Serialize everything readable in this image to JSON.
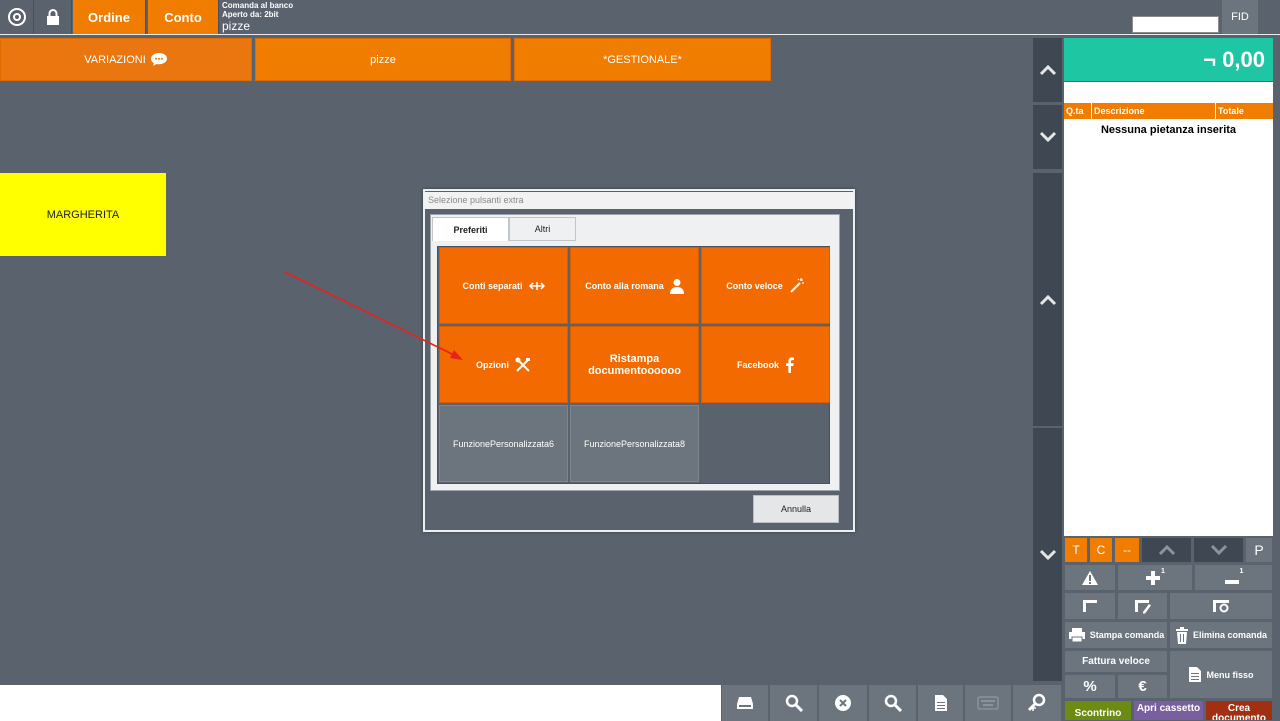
{
  "topbar": {
    "ordine": "Ordine",
    "conto": "Conto",
    "info_line1": "Comanda al banco",
    "info_line2": "Aperto da: 2bit",
    "info_line3": "pizze",
    "fid": "FID"
  },
  "categories": [
    "VARIAZIONI",
    "pizze",
    "*GESTIONALE*"
  ],
  "products": [
    "MARGHERITA"
  ],
  "receipt": {
    "total": "¬ 0,00",
    "col_qty": "Q.ta",
    "col_desc": "Descrizione",
    "col_total": "Totale",
    "empty": "Nessuna pietanza inserita"
  },
  "panel": {
    "t": "T",
    "c": "C",
    "dash": "--",
    "p": "P",
    "plus_badge": "1",
    "minus_badge": "1",
    "stampa": "Stampa comanda",
    "elimina": "Elimina comanda",
    "fattura": "Fattura veloce",
    "menu_fisso": "Menu fisso",
    "percent": "%",
    "euro": "€",
    "scontrino": "Scontrino",
    "apri": "Apri cassetto",
    "crea": "Crea documento"
  },
  "modal": {
    "title": "Selezione pulsanti extra",
    "tabs": [
      "Preferiti",
      "Altri"
    ],
    "buttons": [
      "Conti separati",
      "Conto alla romana",
      "Conto veloce",
      "Opzioni",
      "Ristampa documentoooooo",
      "Facebook",
      "FunzionePersonalizzata6",
      "FunzionePersonalizzata8"
    ],
    "cancel": "Annulla"
  },
  "colors": {
    "orange": "#f07c00",
    "teal": "#1fc6a4",
    "background": "#59626d",
    "yellow": "#ffff00"
  }
}
